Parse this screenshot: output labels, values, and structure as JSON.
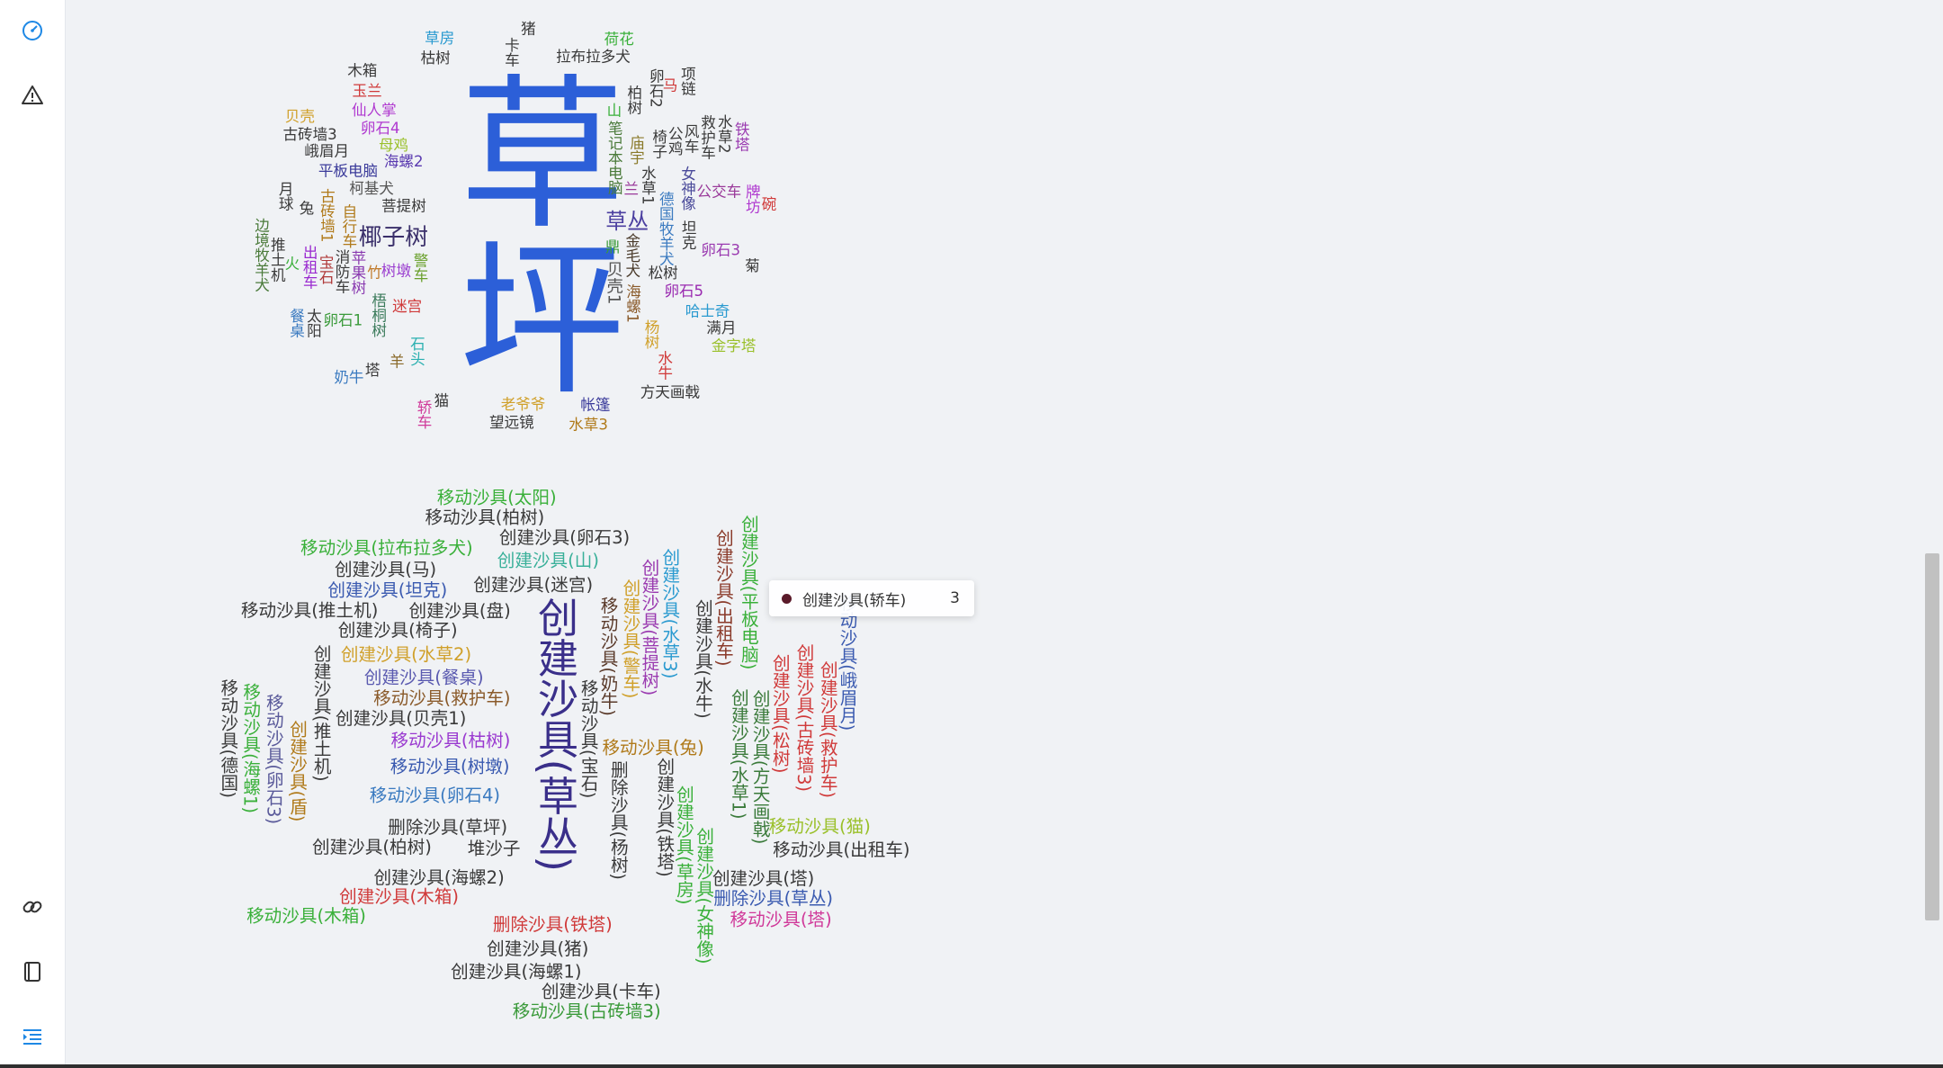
{
  "sidebar": {
    "icons": [
      "dashboard-icon",
      "warning-icon",
      "link-icon",
      "book-icon",
      "menu-list-icon"
    ],
    "active_color": "#1e88e5",
    "icon_color": "#333333"
  },
  "chart_data": [
    {
      "type": "wordcloud",
      "words": [
        {
          "text": "草坪",
          "weight": 200,
          "color": "#2c5fd8"
        },
        {
          "text": "椰子树",
          "weight": 28,
          "color": "#3a2f6a"
        },
        {
          "text": "草丛",
          "weight": 26,
          "color": "#4b3fa0"
        },
        {
          "text": "贝壳1",
          "weight": 20,
          "color": "#555555"
        },
        {
          "text": "警车",
          "weight": 18,
          "color": "#6aa02c"
        },
        {
          "text": "菩提树",
          "weight": 18,
          "color": "#3a3a3a"
        },
        {
          "text": "笔记本电脑",
          "weight": 18,
          "color": "#4a7a3a"
        },
        {
          "text": "金毛犬",
          "weight": 18,
          "color": "#4a3a2a"
        },
        {
          "text": "树墩",
          "weight": 18,
          "color": "#9b3fd0"
        },
        {
          "text": "海螺2",
          "weight": 18,
          "color": "#5a3ab0"
        },
        {
          "text": "鼎",
          "weight": 18,
          "color": "#3a9a3a"
        },
        {
          "text": "水草1",
          "weight": 18,
          "color": "#3a3a3a"
        },
        {
          "text": "迷宫",
          "weight": 18,
          "color": "#d03a3a"
        },
        {
          "text": "德国牧羊犬",
          "weight": 18,
          "color": "#3a7ac0"
        },
        {
          "text": "海螺1",
          "weight": 18,
          "color": "#8a5a2a"
        },
        {
          "text": "柯基犬",
          "weight": 18,
          "color": "#555555"
        },
        {
          "text": "竹",
          "weight": 18,
          "color": "#c07a2a"
        },
        {
          "text": "苹果树",
          "weight": 18,
          "color": "#8a3ab0"
        },
        {
          "text": "松树",
          "weight": 18,
          "color": "#3a3a3a"
        },
        {
          "text": "庙宇",
          "weight": 18,
          "color": "#8a7a2a"
        },
        {
          "text": "自行车",
          "weight": 18,
          "color": "#b07a1a"
        },
        {
          "text": "坦克",
          "weight": 18,
          "color": "#3a3a3a"
        },
        {
          "text": "母鸡",
          "weight": 18,
          "color": "#9ac02a"
        },
        {
          "text": "梧桐树",
          "weight": 18,
          "color": "#3a7a5a"
        },
        {
          "text": "平板电脑",
          "weight": 18,
          "color": "#3a3a9a"
        },
        {
          "text": "椅子",
          "weight": 18,
          "color": "#3a3a3a"
        },
        {
          "text": "女神像",
          "weight": 18,
          "color": "#4a4a9a"
        },
        {
          "text": "卵石4",
          "weight": 18,
          "color": "#b03ad0"
        },
        {
          "text": "山",
          "weight": 18,
          "color": "#3ab03a"
        },
        {
          "text": "兰",
          "weight": 18,
          "color": "#9a3a9a"
        },
        {
          "text": "卵石5",
          "weight": 18,
          "color": "#9a2ab0"
        },
        {
          "text": "石头",
          "weight": 18,
          "color": "#2ab0b0"
        },
        {
          "text": "消防车",
          "weight": 18,
          "color": "#3a3a3a"
        },
        {
          "text": "杨树",
          "weight": 18,
          "color": "#d0a02a"
        },
        {
          "text": "古砖墙1",
          "weight": 18,
          "color": "#b07a1a"
        },
        {
          "text": "卵石1",
          "weight": 18,
          "color": "#3a9a3a"
        },
        {
          "text": "公鸡",
          "weight": 18,
          "color": "#3a3a3a"
        },
        {
          "text": "仙人掌",
          "weight": 18,
          "color": "#b03ad0"
        },
        {
          "text": "公交车",
          "weight": 18,
          "color": "#9a3a9a"
        },
        {
          "text": "卵石3",
          "weight": 18,
          "color": "#9a3ab0"
        },
        {
          "text": "宝石",
          "weight": 18,
          "color": "#b03a3a"
        },
        {
          "text": "柏树",
          "weight": 18,
          "color": "#3a3a3a"
        },
        {
          "text": "羊",
          "weight": 18,
          "color": "#8a6a2a"
        },
        {
          "text": "风车",
          "weight": 18,
          "color": "#3a3a3a"
        },
        {
          "text": "峨眉月",
          "weight": 18,
          "color": "#3a3a3a"
        },
        {
          "text": "出租车",
          "weight": 18,
          "color": "#9a2ad0"
        },
        {
          "text": "兔",
          "weight": 18,
          "color": "#3a3a3a"
        },
        {
          "text": "卡车",
          "weight": 18,
          "color": "#3a3a3a"
        },
        {
          "text": "卵石2",
          "weight": 18,
          "color": "#3a3a3a"
        },
        {
          "text": "哈士奇",
          "weight": 18,
          "color": "#2a9ad0"
        },
        {
          "text": "救护车",
          "weight": 18,
          "color": "#3a3a3a"
        },
        {
          "text": "水牛",
          "weight": 18,
          "color": "#d03a3a"
        },
        {
          "text": "老爷爷",
          "weight": 18,
          "color": "#d0a02a"
        },
        {
          "text": "猫",
          "weight": 18,
          "color": "#3a3a3a"
        },
        {
          "text": "玉兰",
          "weight": 18,
          "color": "#d03a3a"
        },
        {
          "text": "枯树",
          "weight": 18,
          "color": "#3a3a3a"
        },
        {
          "text": "拉布拉多犬",
          "weight": 18,
          "color": "#3a3a3a"
        },
        {
          "text": "塔",
          "weight": 18,
          "color": "#3a3a3a"
        },
        {
          "text": "火",
          "weight": 18,
          "color": "#3ab03a"
        },
        {
          "text": "帐篷",
          "weight": 18,
          "color": "#3a3a9a"
        },
        {
          "text": "古砖墙3",
          "weight": 18,
          "color": "#3a3a3a"
        },
        {
          "text": "太阳",
          "weight": 18,
          "color": "#3a3a3a"
        },
        {
          "text": "月球",
          "weight": 18,
          "color": "#3a3a3a"
        },
        {
          "text": "水草2",
          "weight": 18,
          "color": "#3a3a3a"
        },
        {
          "text": "牌坊",
          "weight": 18,
          "color": "#b03ad0"
        },
        {
          "text": "马",
          "weight": 18,
          "color": "#d03a3a"
        },
        {
          "text": "满月",
          "weight": 18,
          "color": "#3a3a3a"
        },
        {
          "text": "菊",
          "weight": 18,
          "color": "#3a3a3a"
        },
        {
          "text": "望远镜",
          "weight": 18,
          "color": "#3a3a3a"
        },
        {
          "text": "奶牛",
          "weight": 18,
          "color": "#3a7ac0"
        },
        {
          "text": "推土机",
          "weight": 18,
          "color": "#3a3a3a"
        },
        {
          "text": "木箱",
          "weight": 18,
          "color": "#3a3a3a"
        },
        {
          "text": "轿车",
          "weight": 18,
          "color": "#d03a9a"
        },
        {
          "text": "餐桌",
          "weight": 18,
          "color": "#3a7ac0"
        },
        {
          "text": "草房",
          "weight": 18,
          "color": "#2a9ad0"
        },
        {
          "text": "猪",
          "weight": 18,
          "color": "#3a3a3a"
        },
        {
          "text": "方天画戟",
          "weight": 18,
          "color": "#3a3a3a"
        },
        {
          "text": "水草3",
          "weight": 18,
          "color": "#b07a1a"
        },
        {
          "text": "项链",
          "weight": 18,
          "color": "#3a3a3a"
        },
        {
          "text": "铁塔",
          "weight": 18,
          "color": "#9a3ab0"
        },
        {
          "text": "贝壳",
          "weight": 18,
          "color": "#d0a02a"
        },
        {
          "text": "荷花",
          "weight": 18,
          "color": "#3ab03a"
        },
        {
          "text": "碗",
          "weight": 18,
          "color": "#d03a3a"
        },
        {
          "text": "金字塔",
          "weight": 18,
          "color": "#9ac02a"
        },
        {
          "text": "边境牧羊犬",
          "weight": 18,
          "color": "#4a7a3a"
        }
      ]
    },
    {
      "type": "wordcloud",
      "tooltip": {
        "label": "创建沙具(轿车)",
        "value": 3
      },
      "words": [
        {
          "text": "创建沙具(草丛)",
          "weight": 46,
          "color": "#3a2f8a"
        },
        {
          "text": "移动沙具(树墩)",
          "weight": 20,
          "color": "#3a5ab0"
        },
        {
          "text": "移动沙具(枯树)",
          "weight": 20,
          "color": "#9a3ad0"
        },
        {
          "text": "移动沙具(宝石)",
          "weight": 20,
          "color": "#3a3a3a"
        },
        {
          "text": "移动沙具(卵石4)",
          "weight": 20,
          "color": "#3a7ac0"
        },
        {
          "text": "移动沙具(救护车)",
          "weight": 20,
          "color": "#8a5a2a"
        },
        {
          "text": "移动沙具(兔)",
          "weight": 20,
          "color": "#b07a1a"
        },
        {
          "text": "删除沙具(杨树)",
          "weight": 20,
          "color": "#3a3a3a"
        },
        {
          "text": "移动沙具(奶牛)",
          "weight": 20,
          "color": "#5a3a2a"
        },
        {
          "text": "删除沙具(草坪)",
          "weight": 20,
          "color": "#3a3a3a"
        },
        {
          "text": "创建沙具(贝壳1)",
          "weight": 20,
          "color": "#3a3a3a"
        },
        {
          "text": "创建沙具(铁塔)",
          "weight": 20,
          "color": "#3a3a3a"
        },
        {
          "text": "创建沙具(警车)",
          "weight": 20,
          "color": "#d0a02a"
        },
        {
          "text": "创建沙具(菩提树)",
          "weight": 20,
          "color": "#9a3ab0"
        },
        {
          "text": "创建沙具(餐桌)",
          "weight": 20,
          "color": "#5a5ab0"
        },
        {
          "text": "创建沙具(草房)",
          "weight": 20,
          "color": "#3ab03a"
        },
        {
          "text": "创建沙具(海螺2)",
          "weight": 20,
          "color": "#3a3a3a"
        },
        {
          "text": "创建沙具(水草2)",
          "weight": 20,
          "color": "#d0a02a"
        },
        {
          "text": "创建沙具(水牛)",
          "weight": 20,
          "color": "#3a3a3a"
        },
        {
          "text": "堆沙子",
          "weight": 20,
          "color": "#3a3a3a"
        },
        {
          "text": "创建沙具(水草1)",
          "weight": 20,
          "color": "#3a7a3a"
        },
        {
          "text": "创建沙具(柏树)",
          "weight": 20,
          "color": "#3a3a3a"
        },
        {
          "text": "创建沙具(水草3)",
          "weight": 20,
          "color": "#2a9ad0"
        },
        {
          "text": "删除沙具(铁塔)",
          "weight": 20,
          "color": "#d03a3a"
        },
        {
          "text": "创建沙具(椅子)",
          "weight": 20,
          "color": "#3a3a3a"
        },
        {
          "text": "创建沙具(方天画戟)",
          "weight": 20,
          "color": "#3a7a3a"
        },
        {
          "text": "创建沙具(迷宫)",
          "weight": 20,
          "color": "#3a3a3a"
        },
        {
          "text": "创建沙具(松树)",
          "weight": 20,
          "color": "#d03a3a"
        },
        {
          "text": "创建沙具(推土机)",
          "weight": 20,
          "color": "#3a3a3a"
        },
        {
          "text": "创建沙具(盘)",
          "weight": 20,
          "color": "#3a3a3a"
        },
        {
          "text": "创建沙具(木箱)",
          "weight": 20,
          "color": "#d03a3a"
        },
        {
          "text": "创建沙具(女神像)",
          "weight": 20,
          "color": "#3ab03a"
        },
        {
          "text": "创建沙具(猪)",
          "weight": 20,
          "color": "#3a3a3a"
        },
        {
          "text": "创建沙具(山)",
          "weight": 20,
          "color": "#3ab09a"
        },
        {
          "text": "创建沙具(坦克)",
          "weight": 20,
          "color": "#3a5ab0"
        },
        {
          "text": "创建沙具(海螺1)",
          "weight": 20,
          "color": "#3a3a3a"
        },
        {
          "text": "创建沙具(卵石3)",
          "weight": 20,
          "color": "#3a3a3a"
        },
        {
          "text": "创建沙具(出租车)",
          "weight": 20,
          "color": "#8a3a2a"
        },
        {
          "text": "创建沙具(古砖墙3)",
          "weight": 20,
          "color": "#d03a3a"
        },
        {
          "text": "创建沙具(盾)",
          "weight": 20,
          "color": "#b07a1a"
        },
        {
          "text": "创建沙具(塔)",
          "weight": 20,
          "color": "#3a3a3a"
        },
        {
          "text": "创建沙具(马)",
          "weight": 20,
          "color": "#3a3a3a"
        },
        {
          "text": "创建沙具(平板电脑)",
          "weight": 20,
          "color": "#3ab03a"
        },
        {
          "text": "删除沙具(草丛)",
          "weight": 20,
          "color": "#3a5ab0"
        },
        {
          "text": "创建沙具(救护车)",
          "weight": 20,
          "color": "#d03a3a"
        },
        {
          "text": "移动沙具(推土机)",
          "weight": 20,
          "color": "#3a3a3a"
        },
        {
          "text": "移动沙具(卵石3)",
          "weight": 20,
          "color": "#5a5a9a"
        },
        {
          "text": "创建沙具(卡车)",
          "weight": 20,
          "color": "#3a3a3a"
        },
        {
          "text": "移动沙具(拉布拉多犬)",
          "weight": 20,
          "color": "#3ab03a"
        },
        {
          "text": "移动沙具(柏树)",
          "weight": 20,
          "color": "#3a3a3a"
        },
        {
          "text": "移动沙具(猫)",
          "weight": 20,
          "color": "#9ac02a"
        },
        {
          "text": "移动沙具(海螺1)",
          "weight": 20,
          "color": "#3ab03a"
        },
        {
          "text": "移动沙具(木箱)",
          "weight": 20,
          "color": "#3ab03a"
        },
        {
          "text": "移动沙具(峨眉月)",
          "weight": 20,
          "color": "#3a5ab0"
        },
        {
          "text": "移动沙具(塔)",
          "weight": 20,
          "color": "#d03a9a"
        },
        {
          "text": "移动沙具(古砖墙3)",
          "weight": 20,
          "color": "#3a9a3a"
        },
        {
          "text": "移动沙具(出租车)",
          "weight": 20,
          "color": "#3a3a3a"
        },
        {
          "text": "移动沙具(太阳)",
          "weight": 20,
          "color": "#3ab03a"
        },
        {
          "text": "移动沙具(德国)",
          "weight": 20,
          "color": "#3a3a3a"
        }
      ]
    }
  ]
}
